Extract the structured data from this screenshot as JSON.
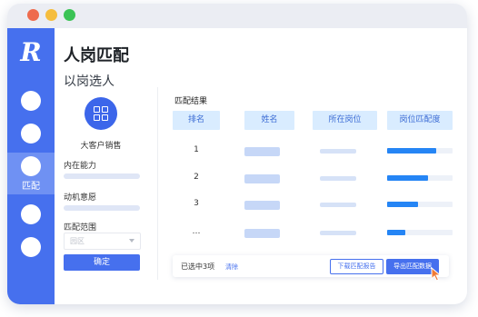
{
  "sidebar": {
    "logo": "R",
    "active_item_label": "匹配"
  },
  "page": {
    "title": "人岗匹配",
    "subtitle": "以岗选人"
  },
  "filter_panel": {
    "role_icon": "grid-icon",
    "role_name": "大客户销售",
    "ability_label": "内在能力",
    "motivation_label": "动机意愿",
    "range_label": "匹配范围",
    "range_placeholder": "园区",
    "confirm_label": "确定"
  },
  "results": {
    "title": "匹配结果",
    "columns": [
      "排名",
      "姓名",
      "所在岗位",
      "岗位匹配度"
    ],
    "rows": [
      {
        "rank": "1",
        "match": 0.75
      },
      {
        "rank": "2",
        "match": 0.62
      },
      {
        "rank": "3",
        "match": 0.47
      },
      {
        "rank": "…",
        "match": 0.28
      }
    ]
  },
  "action_bar": {
    "selected_text": "已选中3项",
    "clear_label": "清除",
    "download_label": "下载匹配报告",
    "export_label": "导出匹配数据"
  },
  "colors": {
    "accent": "#4670ee",
    "header_bg": "#d9ecff",
    "progress": "#2585f5"
  }
}
